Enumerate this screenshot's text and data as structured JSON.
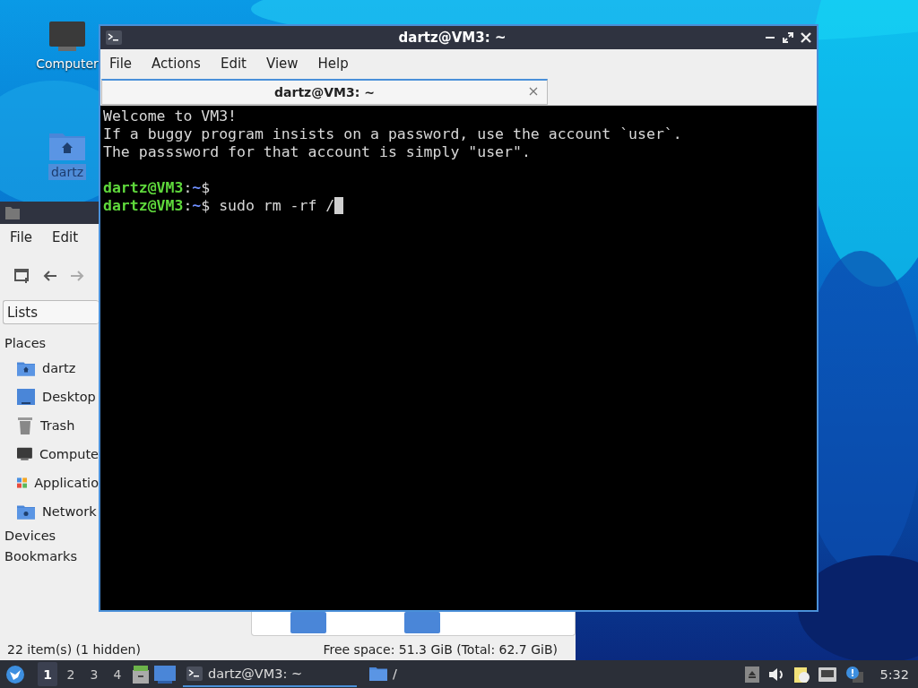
{
  "desktop_icons": [
    {
      "label": "Computer",
      "kind": "computer",
      "selected": false
    },
    {
      "label": "dartz",
      "kind": "home",
      "selected": true
    }
  ],
  "file_manager": {
    "menu": [
      "File",
      "Edit"
    ],
    "location_mode": "Lists",
    "sidebar": [
      {
        "title": "Places",
        "items": [
          {
            "label": "dartz",
            "kind": "home"
          },
          {
            "label": "Desktop",
            "kind": "desktop"
          },
          {
            "label": "Trash",
            "kind": "trash"
          },
          {
            "label": "Compute",
            "kind": "computer"
          },
          {
            "label": "Applicatio",
            "kind": "apps"
          },
          {
            "label": "Network",
            "kind": "network"
          }
        ]
      },
      {
        "title": "Devices"
      },
      {
        "title": "Bookmarks"
      }
    ],
    "status_left": "22 item(s) (1 hidden)",
    "status_right": "Free space: 51.3 GiB (Total: 62.7 GiB)"
  },
  "terminal": {
    "title": "dartz@VM3: ~",
    "menu": [
      "File",
      "Actions",
      "Edit",
      "View",
      "Help"
    ],
    "tabs": [
      {
        "label": "dartz@VM3: ~",
        "selected": true
      }
    ],
    "lines": [
      {
        "kind": "text",
        "text": "Welcome to VM3!"
      },
      {
        "kind": "text",
        "text": "If a buggy program insists on a password, use the account `user`."
      },
      {
        "kind": "text",
        "text": "The passsword for that account is simply \"user\"."
      },
      {
        "kind": "blank"
      },
      {
        "kind": "prompt",
        "user": "dartz@VM3",
        "separator": ":",
        "path": "~",
        "symbol": "$",
        "cursor": false
      },
      {
        "kind": "prompt",
        "user": "dartz@VM3",
        "separator": ":",
        "path": "~",
        "symbol": "$",
        "command": "sudo rm -rf /",
        "cursor": true
      }
    ]
  },
  "taskbar": {
    "workspaces": [
      {
        "label": "1",
        "selected": true
      },
      {
        "label": "2",
        "selected": false
      },
      {
        "label": "3",
        "selected": false
      },
      {
        "label": "4",
        "selected": false
      }
    ],
    "tasks": [
      {
        "label": "dartz@VM3: ~",
        "kind": "terminal",
        "selected": true
      },
      {
        "label": "/",
        "kind": "folder",
        "selected": false
      }
    ],
    "clock": "5:32"
  }
}
